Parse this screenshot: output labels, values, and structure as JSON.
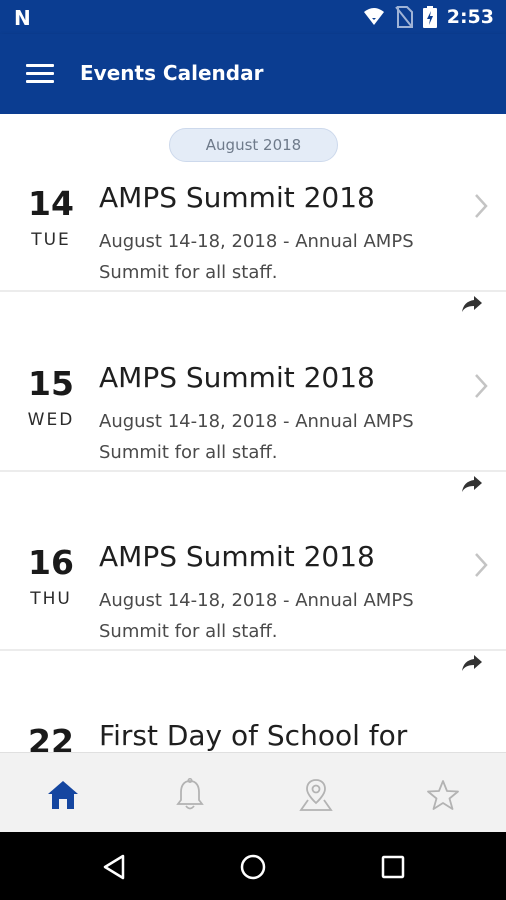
{
  "status_bar": {
    "time": "2:53",
    "logo": "N",
    "icons": [
      "wifi-icon",
      "no-sim-icon",
      "battery-charging-icon"
    ]
  },
  "app_bar": {
    "title": "Events Calendar",
    "menu_icon": "hamburger-menu-icon"
  },
  "month_header": "August 2018",
  "events": [
    {
      "day": "14",
      "dow": "TUE",
      "title": "AMPS Summit 2018",
      "description": "August 14-18, 2018 - Annual AMPS Summit for all staff."
    },
    {
      "day": "15",
      "dow": "WED",
      "title": "AMPS Summit 2018",
      "description": "August 14-18, 2018 - Annual AMPS Summit for all staff."
    },
    {
      "day": "16",
      "dow": "THU",
      "title": "AMPS Summit 2018",
      "description": "August 14-18, 2018 - Annual AMPS Summit for all staff."
    },
    {
      "day": "22",
      "dow": "",
      "title": "First Day of School for",
      "description": ""
    }
  ],
  "bottom_nav": {
    "items": [
      "home-icon",
      "bell-icon",
      "map-pin-icon",
      "star-icon"
    ],
    "active": "home-icon",
    "active_color": "#1546a0",
    "inactive_color": "#b3b3b3"
  },
  "colors": {
    "primary": "#0b3d91",
    "chip_bg": "#e4ecf7"
  }
}
